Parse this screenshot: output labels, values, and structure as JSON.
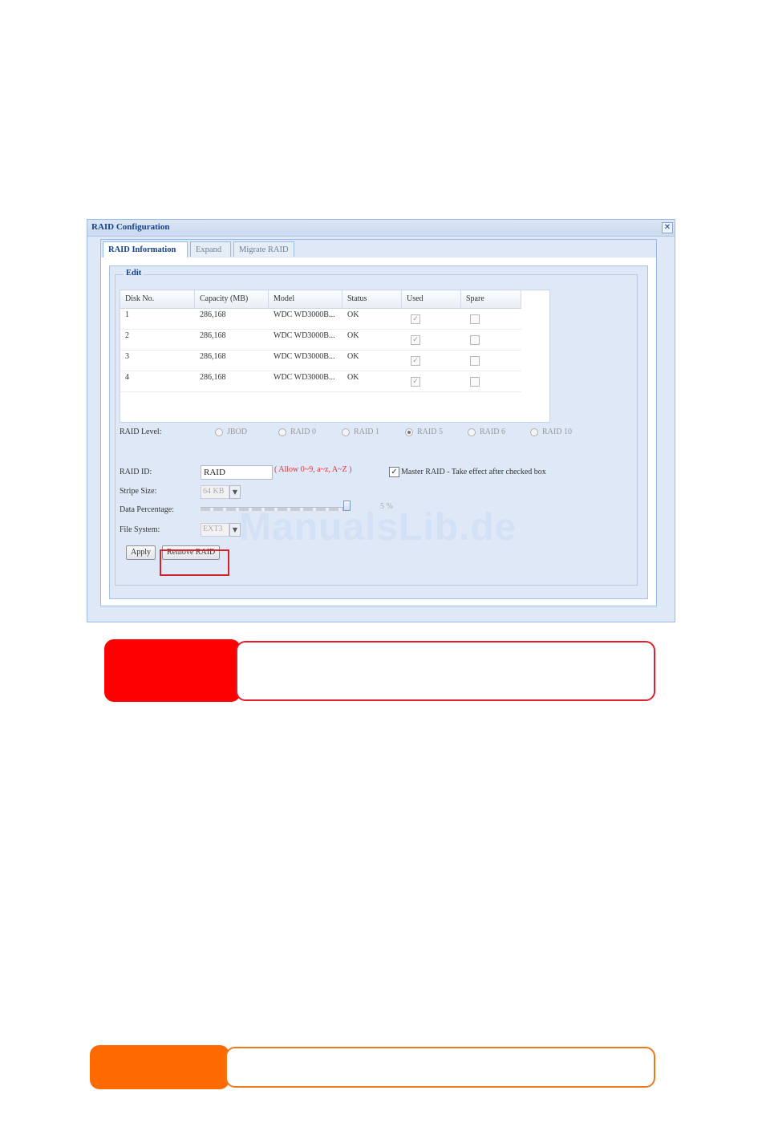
{
  "dialog": {
    "title": "RAID Configuration",
    "close_symbol": "✕",
    "tabs": [
      {
        "label": "RAID Information",
        "active": true
      },
      {
        "label": "Expand",
        "active": false
      },
      {
        "label": "Migrate RAID",
        "active": false
      }
    ],
    "edit_legend": "Edit",
    "grid": {
      "columns": [
        "Disk No.",
        "Capacity (MB)",
        "Model",
        "Status",
        "Used",
        "Spare"
      ],
      "rows": [
        {
          "disk": "1",
          "capacity": "286,168",
          "model": "WDC WD3000B...",
          "status": "OK",
          "used": true,
          "spare": false
        },
        {
          "disk": "2",
          "capacity": "286,168",
          "model": "WDC WD3000B...",
          "status": "OK",
          "used": true,
          "spare": false
        },
        {
          "disk": "3",
          "capacity": "286,168",
          "model": "WDC WD3000B...",
          "status": "OK",
          "used": true,
          "spare": false
        },
        {
          "disk": "4",
          "capacity": "286,168",
          "model": "WDC WD3000B...",
          "status": "OK",
          "used": true,
          "spare": false
        }
      ]
    },
    "raid_level": {
      "label": "RAID Level:",
      "options": [
        "JBOD",
        "RAID 0",
        "RAID 1",
        "RAID 5",
        "RAID 6",
        "RAID 10"
      ],
      "selected": "RAID 5"
    },
    "raid_id": {
      "label": "RAID ID:",
      "value": "RAID",
      "hint": "( Allow 0~9, a~z, A~Z )"
    },
    "master_raid": {
      "checked": true,
      "label": "Master RAID - Take effect after checked box",
      "check_symbol": "✓"
    },
    "stripe_size": {
      "label": "Stripe Size:",
      "value": "64 KB"
    },
    "data_percentage": {
      "label": "Data Percentage:",
      "value_text": "5 %",
      "value": 100
    },
    "file_system": {
      "label": "File System:",
      "value": "EXT3"
    },
    "buttons": {
      "apply": "Apply",
      "remove": "Remove RAID"
    },
    "watermark": "ManualsLib.de"
  },
  "colors": {
    "warning_tag": "#ff0000",
    "warning_border": "#e0202a",
    "note_tag": "#ff6a00",
    "note_border": "#f07a1a",
    "highlight": "#d6212b"
  }
}
